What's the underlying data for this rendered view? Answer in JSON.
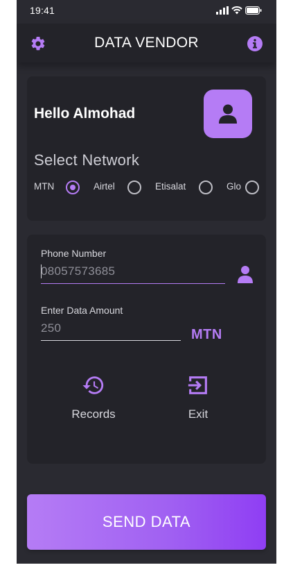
{
  "statusbar": {
    "time": "19:41"
  },
  "appbar": {
    "title": "DATA VENDOR",
    "settings_icon": "gear-icon",
    "info_icon": "info-icon"
  },
  "greeting": {
    "text": "Hello Almohad",
    "avatar_icon": "user-icon"
  },
  "network": {
    "heading": "Select Network",
    "options": [
      {
        "label": "MTN",
        "selected": true
      },
      {
        "label": "Airtel",
        "selected": false
      },
      {
        "label": "Etisalat",
        "selected": false
      },
      {
        "label": "Glo",
        "selected": false
      }
    ]
  },
  "form": {
    "phone_label": "Phone Number",
    "phone_value": "08057573685",
    "amount_label": "Enter Data Amount",
    "amount_value": "250",
    "network_badge": "MTN"
  },
  "actions": {
    "records_label": "Records",
    "exit_label": "Exit"
  },
  "send_button": {
    "label": "SEND DATA"
  },
  "colors": {
    "accent": "#b57cf5",
    "background": "#2a2a31",
    "card": "#232329",
    "appbar": "#232329"
  }
}
